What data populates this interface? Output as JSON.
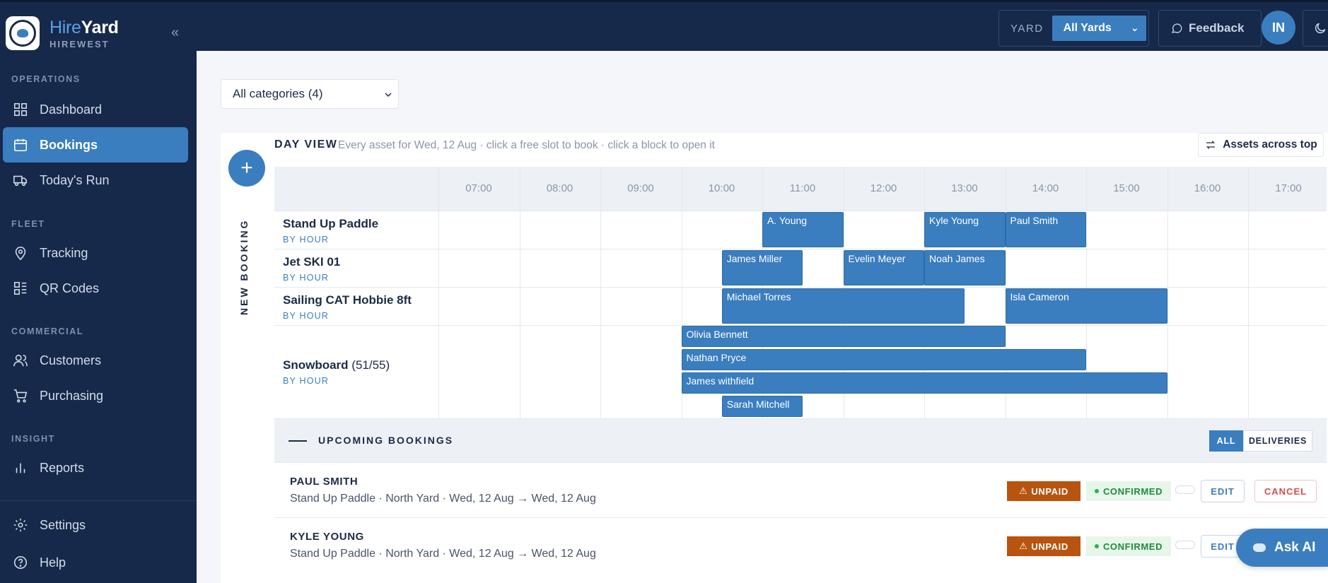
{
  "brand": {
    "name_light": "Hire",
    "name_bold": "Yard",
    "company": "HIREWEST"
  },
  "sidebar": {
    "sections": [
      "OPERATIONS",
      "FLEET",
      "COMMERCIAL",
      "INSIGHT"
    ],
    "items": [
      {
        "label": "Dashboard",
        "icon": "grid-icon"
      },
      {
        "label": "Bookings",
        "icon": "calendar-icon",
        "active": true
      },
      {
        "label": "Today's Run",
        "icon": "truck-icon"
      },
      {
        "label": "Tracking",
        "icon": "pin-icon"
      },
      {
        "label": "QR Codes",
        "icon": "qr-icon"
      },
      {
        "label": "Customers",
        "icon": "users-icon"
      },
      {
        "label": "Purchasing",
        "icon": "cart-icon"
      },
      {
        "label": "Reports",
        "icon": "bar-chart-icon"
      },
      {
        "label": "Settings",
        "icon": "gear-icon"
      },
      {
        "label": "Help",
        "icon": "help-icon"
      }
    ]
  },
  "topbar": {
    "yard_label": "YARD",
    "yard_value": "All Yards",
    "feedback_label": "Feedback",
    "avatar_initials": "IN"
  },
  "filters": {
    "category": "All categories (4)"
  },
  "day_view": {
    "title": "DAY VIEW",
    "description": "Every asset for Wed, 12 Aug · click a free slot to book · click a block to open it",
    "assets_toggle": "Assets across top",
    "new_booking_label": "NEW BOOKING",
    "hours": [
      "07:00",
      "08:00",
      "09:00",
      "10:00",
      "11:00",
      "12:00",
      "13:00",
      "14:00",
      "15:00",
      "16:00",
      "17:00"
    ],
    "assets": [
      {
        "name": "Stand Up Paddle",
        "count": "",
        "rate": "BY HOUR"
      },
      {
        "name": "Jet SKI 01",
        "count": "",
        "rate": "BY HOUR"
      },
      {
        "name": "Sailing CAT Hobbie 8ft",
        "count": "",
        "rate": "BY HOUR"
      },
      {
        "name": "Snowboard",
        "count": "(51/55)",
        "rate": "BY HOUR"
      }
    ],
    "bookings": [
      {
        "asset": 0,
        "lane": 0,
        "name": "A. Young",
        "start": 11.0,
        "end": 12.0
      },
      {
        "asset": 0,
        "lane": 0,
        "name": "Kyle Young",
        "start": 13.0,
        "end": 14.0
      },
      {
        "asset": 0,
        "lane": 0,
        "name": "Paul Smith",
        "start": 14.0,
        "end": 15.0
      },
      {
        "asset": 1,
        "lane": 0,
        "name": "James Miller",
        "start": 10.5,
        "end": 11.5
      },
      {
        "asset": 1,
        "lane": 0,
        "name": "Evelin Meyer",
        "start": 12.0,
        "end": 13.0
      },
      {
        "asset": 1,
        "lane": 0,
        "name": "Noah James",
        "start": 13.0,
        "end": 14.0
      },
      {
        "asset": 2,
        "lane": 0,
        "name": "Michael Torres",
        "start": 10.5,
        "end": 13.5
      },
      {
        "asset": 2,
        "lane": 0,
        "name": "Isla Cameron",
        "start": 14.0,
        "end": 16.0
      },
      {
        "asset": 3,
        "lane": 0,
        "name": "Olivia Bennett",
        "start": 10.0,
        "end": 14.0
      },
      {
        "asset": 3,
        "lane": 1,
        "name": "Nathan Pryce",
        "start": 10.0,
        "end": 15.0
      },
      {
        "asset": 3,
        "lane": 2,
        "name": "James withfield",
        "start": 10.0,
        "end": 16.0
      },
      {
        "asset": 3,
        "lane": 3,
        "name": "Sarah Mitchell",
        "start": 10.5,
        "end": 11.5
      }
    ]
  },
  "upcoming": {
    "title": "UPCOMING BOOKINGS",
    "filter_all": "ALL",
    "filter_deliveries": "DELIVERIES",
    "items": [
      {
        "name": "PAUL SMITH",
        "detail": "Stand Up Paddle · North Yard · Wed, 12 Aug → Wed, 12 Aug",
        "payment": "UNPAID",
        "status": "CONFIRMED",
        "edit": "EDIT",
        "cancel": "CANCEL"
      },
      {
        "name": "KYLE YOUNG",
        "detail": "Stand Up Paddle · North Yard · Wed, 12 Aug → Wed, 12 Aug",
        "payment": "UNPAID",
        "status": "CONFIRMED",
        "edit": "EDIT",
        "cancel": ""
      }
    ]
  },
  "ask_ai": "Ask AI",
  "colors": {
    "navy": "#16294a",
    "accent": "#3a7ebf",
    "unpaid": "#b85410",
    "confirmed": "#218a3c",
    "cancel": "#d94b4b"
  }
}
